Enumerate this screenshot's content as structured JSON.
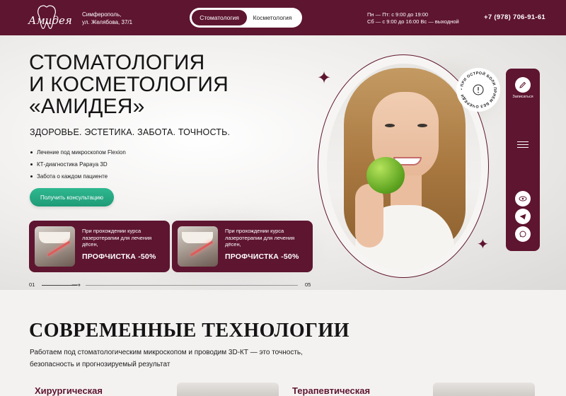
{
  "header": {
    "logo_text": "Амидея",
    "address_line1": "Симферополь,",
    "address_line2": "ул. Желябова, 37/1",
    "tabs": [
      {
        "label": "Стоматология",
        "active": true
      },
      {
        "label": "Косметология",
        "active": false
      }
    ],
    "hours_line1": "Пн — Пт: с 9:00 до 19:00",
    "hours_line2": "Сб — с 9:00 до 16:00  Вс — выходной",
    "phone": "+7 (978) 706-91-61"
  },
  "hero": {
    "title_line1": "СТОМАТОЛОГИЯ",
    "title_line2": "И КОСМЕТОЛОГИЯ",
    "title_line3": "«АМИДЕЯ»",
    "subtitle": "ЗДОРОВЬЕ. ЭСТЕТИКА. ЗАБОТА. ТОЧНОСТЬ.",
    "bullets": [
      "Лечение под микроскопом Flexion",
      "КТ-диагностика Papaya 3D",
      "Забота о каждом пациенте"
    ],
    "cta_label": "Получить консультацию",
    "badge_text": "• ПРИ ОСТРОЙ БОЛИ ПРИЕМ БЕЗ ОЧЕРЕДИ"
  },
  "promos": [
    {
      "text": "При прохождении курса лазеротерапии для лечения дёсен,",
      "discount": "ПРОФЧИСТКА -50%"
    },
    {
      "text": "При прохождении курса лазеротерапии для лечения дёсен,",
      "discount": "ПРОФЧИСТКА -50%"
    }
  ],
  "pager": {
    "current": "01",
    "total": "05"
  },
  "side_panel": {
    "write_label": "Записаться",
    "icons": [
      "edit-icon",
      "menu-icon",
      "eye-icon",
      "telegram-icon",
      "whatsapp-icon"
    ]
  },
  "technologies": {
    "title": "СОВРЕМЕННЫЕ ТЕХНОЛОГИИ",
    "text": "Работаем под стоматологическим микроскопом и проводим 3D-КТ — это точность, безопасность и прогнозируемый результат",
    "cards": [
      {
        "title": "Хирургическая"
      },
      {
        "title": "Терапевтическая"
      }
    ]
  },
  "colors": {
    "brand": "#5e1530",
    "accent": "#24a982",
    "background": "#f4f2f1"
  }
}
